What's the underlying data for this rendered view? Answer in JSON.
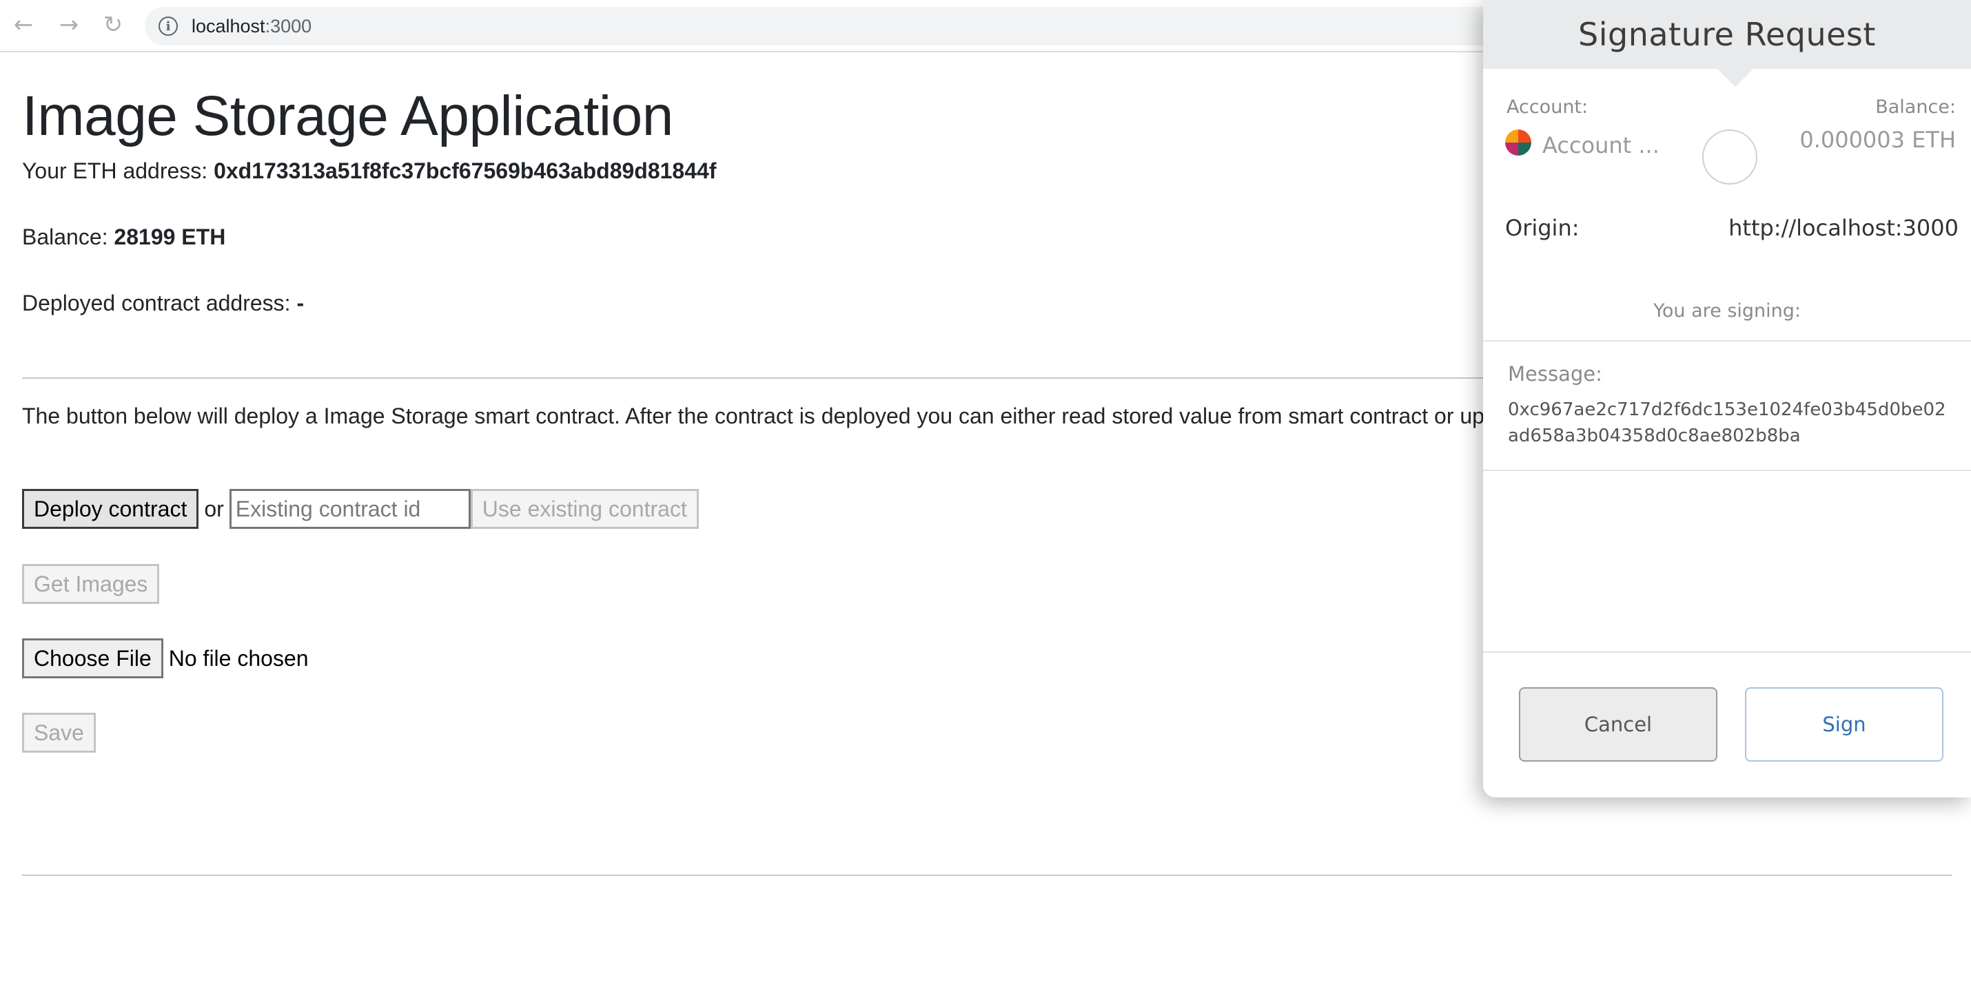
{
  "browser": {
    "url_host": "localhost",
    "url_port": ":3000"
  },
  "page": {
    "title": "Image Storage Application",
    "address_label": "Your ETH address: ",
    "address_value": "0xd173313a51f8fc37bcf67569b463abd89d81844f",
    "balance_label": "Balance: ",
    "balance_value": "28199 ETH",
    "contract_label": "Deployed contract address: ",
    "contract_value": "-",
    "description": "The button below will deploy a Image Storage smart contract. After the contract is deployed you can either read stored value from smart contract or update it using the interface below.",
    "deploy_button": "Deploy contract",
    "or_text": "or",
    "contract_id_placeholder": "Existing contract id",
    "use_existing_button": "Use existing contract",
    "get_images_button": "Get Images",
    "choose_file_button": "Choose File",
    "file_status": "No file chosen",
    "save_button": "Save"
  },
  "popup": {
    "title": "Signature Request",
    "account_label": "Account:",
    "account_name": "Account ...",
    "balance_label": "Balance:",
    "balance_value": "0.000003 ETH",
    "origin_label": "Origin:",
    "origin_value": "http://localhost:3000",
    "signing_label": "You are signing:",
    "message_label": "Message:",
    "message_value": "0xc967ae2c717d2f6dc153e1024fe03b45d0be02ad658a3b04358d0c8ae802b8ba",
    "cancel_button": "Cancel",
    "sign_button": "Sign"
  }
}
